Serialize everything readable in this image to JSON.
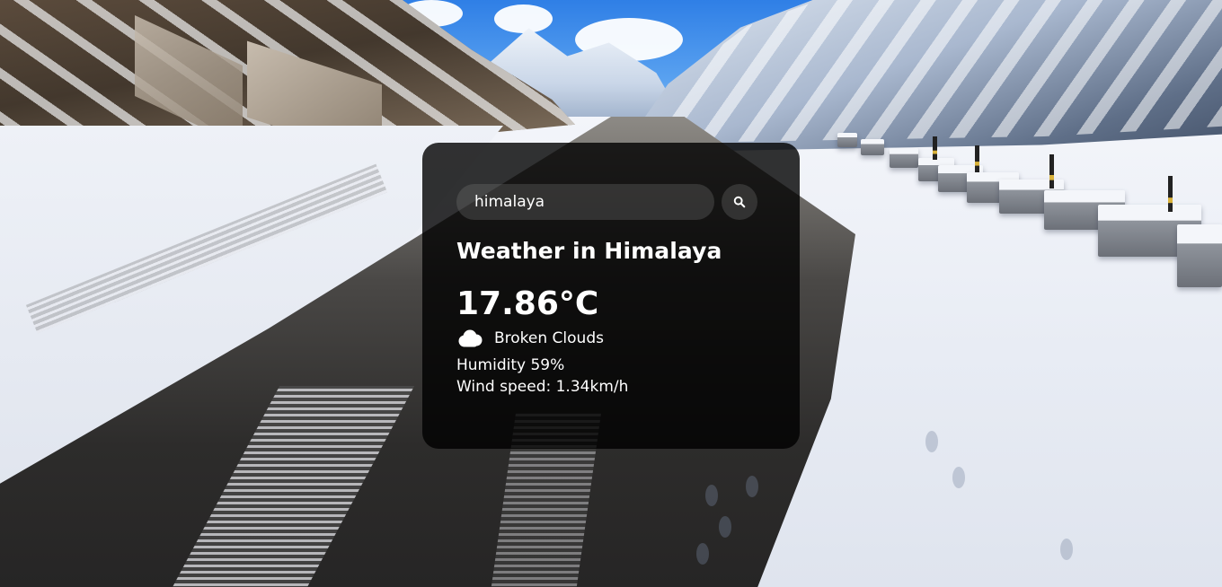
{
  "search": {
    "value": "himalaya",
    "icon": "search-icon"
  },
  "weather": {
    "city_heading": "Weather in Himalaya",
    "temperature": "17.86°C",
    "condition_icon": "cloud-icon",
    "description": "Broken Clouds",
    "humidity": "Humidity 59%",
    "wind_speed": "Wind speed: 1.34km/h"
  },
  "colors": {
    "card_background": "#000000",
    "text": "#ffffff"
  }
}
